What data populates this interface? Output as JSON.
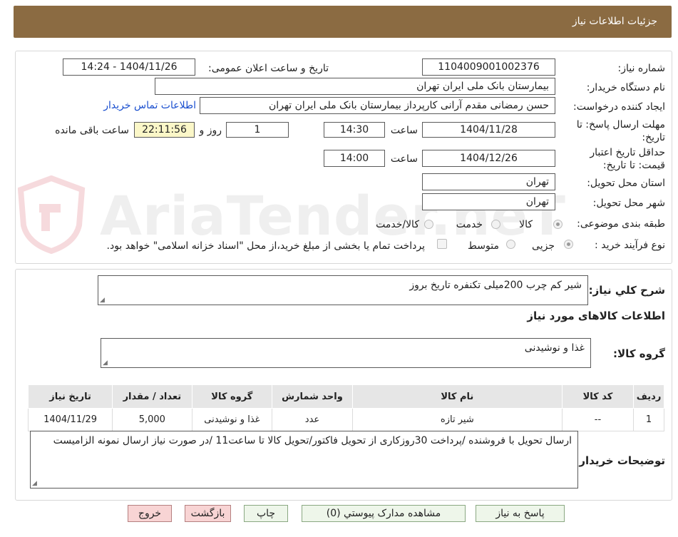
{
  "header": {
    "title": "جزئیات اطلاعات نیاز"
  },
  "form": {
    "need_number_label": "شماره نیاز:",
    "need_number": "1104009001002376",
    "announce_label": "تاریخ و ساعت اعلان عمومی:",
    "announce_value": "1404/11/26 - 14:24",
    "buyer_org_label": "نام دستگاه خریدار:",
    "buyer_org": "بیمارستان بانک ملی ایران تهران",
    "requester_label": "ایجاد کننده درخواست:",
    "requester": "حسن رمضانی مقدم آرانی کارپرداز بیمارستان بانک ملی ایران تهران",
    "contact_link": "اطلاعات تماس خریدار",
    "deadline_label": "مهلت ارسال پاسخ: تا تاریخ:",
    "deadline_date": "1404/11/28",
    "time_label": "ساعت",
    "deadline_time": "14:30",
    "days_value": "1",
    "days_label": "روز و",
    "remaining_time": "22:11:56",
    "remaining_label": "ساعت باقی مانده",
    "validity_label": "حداقل تاریخ اعتبار قیمت: تا تاریخ:",
    "validity_date": "1404/12/26",
    "validity_time": "14:00",
    "province_label": "استان محل تحویل:",
    "province": "تهران",
    "city_label": "شهر محل تحویل:",
    "city": "تهران",
    "category_label": "طبقه بندی موضوعی:",
    "category_options": [
      "کالا",
      "خدمت",
      "کالا/خدمت"
    ],
    "category_selected": "کالا",
    "process_label": "نوع فرآیند خرید :",
    "process_options": [
      "جزیی",
      "متوسط"
    ],
    "process_selected": "جزیی",
    "treasury_note": "پرداخت تمام یا بخشی از مبلغ خرید،از محل \"اسناد خزانه اسلامی\" خواهد بود."
  },
  "details": {
    "summary_label": "شرح کلي نياز:",
    "summary": "شیر کم چرب 200میلی تکنفره تاریخ بروز",
    "goods_info_title": "اطلاعات کالاهای مورد نیاز",
    "goods_group_label": "گروه کالا:",
    "goods_group": "غذا و نوشیدنی",
    "table": {
      "headers": [
        "ردیف",
        "کد کالا",
        "نام کالا",
        "واحد شمارش",
        "گروه کالا",
        "تعداد / مقدار",
        "تاریخ نیاز"
      ],
      "rows": [
        [
          "1",
          "--",
          "شیر تازه",
          "عدد",
          "غذا و نوشیدنی",
          "5,000",
          "1404/11/29"
        ]
      ]
    },
    "buyer_notes_label": "توضیحات خریدار:",
    "buyer_notes": "ارسال تحویل با فروشنده /پرداخت 30روزکاری از تحویل فاکتور/تحویل کالا تا ساعت11 /در صورت نیاز ارسال نمونه الزامیست"
  },
  "buttons": {
    "reply": "پاسخ به نیاز",
    "attachments": "مشاهده مدارک پیوستي (0)",
    "print": "چاپ",
    "back": "بازگشت",
    "exit": "خروج"
  },
  "watermark": "AriaTender.neT",
  "colors": {
    "title_bar": "#8b6b42",
    "link": "#1a4fcf",
    "remaining_bg": "#fbf7c8"
  }
}
